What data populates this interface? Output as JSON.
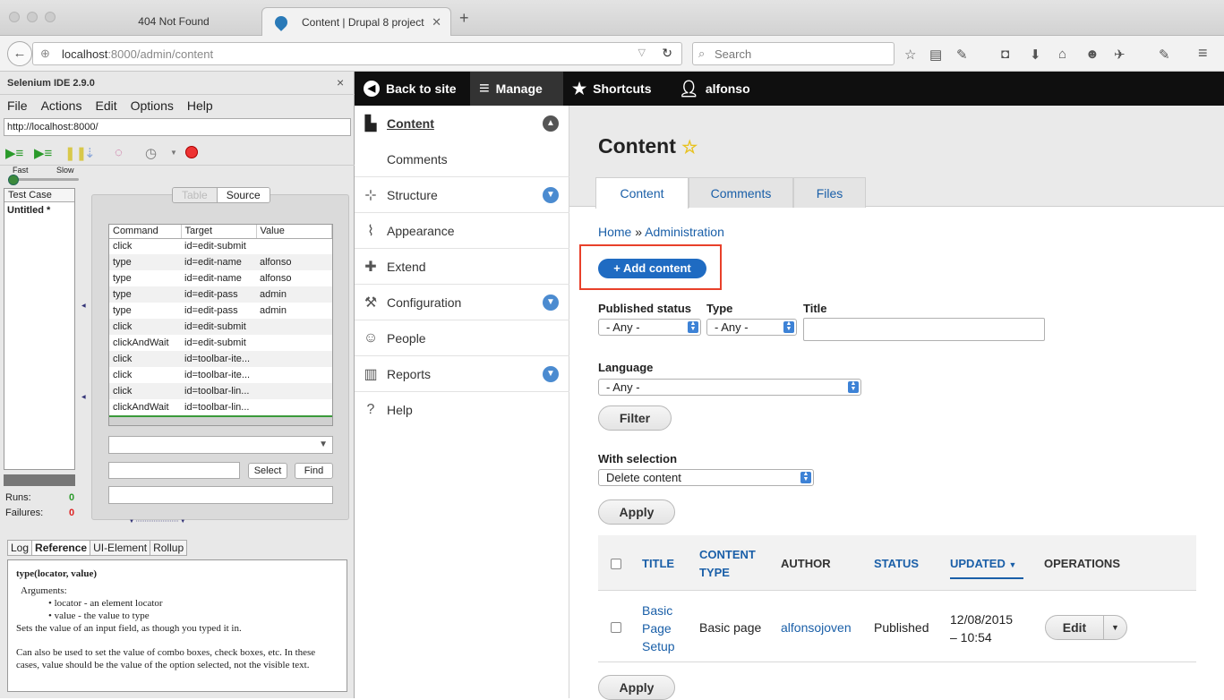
{
  "browser": {
    "tabs": [
      {
        "label": "404 Not Found"
      },
      {
        "label": "Content | Drupal 8 project"
      }
    ],
    "new_tab": "+",
    "url": {
      "host": "localhost",
      "rest": ":8000/admin/content"
    },
    "search_placeholder": "Search"
  },
  "selenium": {
    "title": "Selenium IDE 2.9.0",
    "close": "×",
    "menu": [
      "File",
      "Actions",
      "Edit",
      "Options",
      "Help"
    ],
    "base_url": "http://localhost:8000/",
    "speed": {
      "fast": "Fast",
      "slow": "Slow"
    },
    "test_case_header": "Test Case",
    "test_case_name": "Untitled *",
    "view_tabs": [
      "Table",
      "Source"
    ],
    "columns": [
      "Command",
      "Target",
      "Value"
    ],
    "commands": [
      [
        "click",
        "id=edit-submit",
        ""
      ],
      [
        "type",
        "id=edit-name",
        "alfonso"
      ],
      [
        "type",
        "id=edit-name",
        "alfonso"
      ],
      [
        "type",
        "id=edit-pass",
        "admin"
      ],
      [
        "type",
        "id=edit-pass",
        "admin"
      ],
      [
        "click",
        "id=edit-submit",
        ""
      ],
      [
        "clickAndWait",
        "id=edit-submit",
        ""
      ],
      [
        "click",
        "id=toolbar-ite...",
        ""
      ],
      [
        "click",
        "id=toolbar-ite...",
        ""
      ],
      [
        "click",
        "id=toolbar-lin...",
        ""
      ],
      [
        "clickAndWait",
        "id=toolbar-lin...",
        ""
      ]
    ],
    "select_btn": "Select",
    "find_btn": "Find",
    "runs_label": "Runs:",
    "runs": "0",
    "failures_label": "Failures:",
    "failures": "0",
    "log_tabs": [
      "Log",
      "Reference",
      "UI-Element",
      "Rollup"
    ],
    "ref": {
      "signature": "type(locator, value)",
      "args_label": "Arguments:",
      "args": [
        "locator - an element locator",
        "value - the value to type"
      ],
      "desc1": "Sets the value of an input field, as though you typed it in.",
      "desc2": "Can also be used to set the value of combo boxes, check boxes, etc. In these cases, value should be the value of the option selected, not the visible text."
    }
  },
  "toolbar": {
    "back": "Back to site",
    "manage": "Manage",
    "shortcuts": "Shortcuts",
    "user": "alfonso"
  },
  "sidebar": {
    "items": [
      {
        "label": "Content"
      },
      {
        "label": "Comments"
      },
      {
        "label": "Structure"
      },
      {
        "label": "Appearance"
      },
      {
        "label": "Extend"
      },
      {
        "label": "Configuration"
      },
      {
        "label": "People"
      },
      {
        "label": "Reports"
      },
      {
        "label": "Help"
      }
    ]
  },
  "main": {
    "title": "Content",
    "tabs": [
      "Content",
      "Comments",
      "Files"
    ],
    "breadcrumb": {
      "home": "Home",
      "sep": "»",
      "admin": "Administration"
    },
    "add_button": "+ Add content",
    "filters": {
      "published_label": "Published status",
      "published_value": "- Any -",
      "type_label": "Type",
      "type_value": "- Any -",
      "title_label": "Title",
      "language_label": "Language",
      "language_value": "- Any -",
      "filter_btn": "Filter"
    },
    "with_selection_label": "With selection",
    "with_selection_value": "Delete content",
    "apply_btn": "Apply",
    "table": {
      "headers": {
        "title": "TITLE",
        "content": "CONTENT",
        "type": "TYPE",
        "author": "AUTHOR",
        "status": "STATUS",
        "updated": "UPDATED",
        "operations": "OPERATIONS"
      },
      "row": {
        "title1": "Basic",
        "title2": "Page",
        "title3": "Setup",
        "type": "Basic page",
        "author": "alfonsojoven",
        "status": "Published",
        "updated1": "12/08/2015",
        "updated2": "– 10:54",
        "edit": "Edit"
      }
    },
    "apply_btn2": "Apply"
  }
}
